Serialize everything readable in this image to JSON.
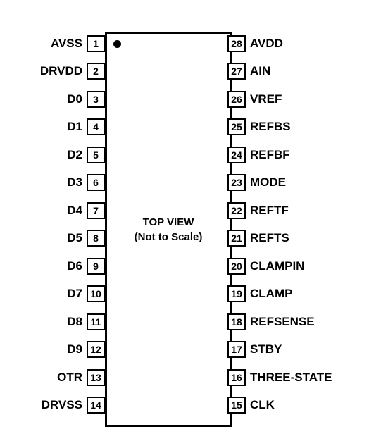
{
  "chip": {
    "top_text": "TOP VIEW",
    "sub_text": "(Not to Scale)"
  },
  "left_pins": [
    {
      "num": "1",
      "label": "AVSS"
    },
    {
      "num": "2",
      "label": "DRVDD"
    },
    {
      "num": "3",
      "label": "D0"
    },
    {
      "num": "4",
      "label": "D1"
    },
    {
      "num": "5",
      "label": "D2"
    },
    {
      "num": "6",
      "label": "D3"
    },
    {
      "num": "7",
      "label": "D4"
    },
    {
      "num": "8",
      "label": "D5"
    },
    {
      "num": "9",
      "label": "D6"
    },
    {
      "num": "10",
      "label": "D7"
    },
    {
      "num": "11",
      "label": "D8"
    },
    {
      "num": "12",
      "label": "D9"
    },
    {
      "num": "13",
      "label": "OTR"
    },
    {
      "num": "14",
      "label": "DRVSS"
    }
  ],
  "right_pins": [
    {
      "num": "28",
      "label": "AVDD"
    },
    {
      "num": "27",
      "label": "AIN"
    },
    {
      "num": "26",
      "label": "VREF"
    },
    {
      "num": "25",
      "label": "REFBS"
    },
    {
      "num": "24",
      "label": "REFBF"
    },
    {
      "num": "23",
      "label": "MODE"
    },
    {
      "num": "22",
      "label": "REFTF"
    },
    {
      "num": "21",
      "label": "REFTS"
    },
    {
      "num": "20",
      "label": "CLAMPIN"
    },
    {
      "num": "19",
      "label": "CLAMP"
    },
    {
      "num": "18",
      "label": "REFSENSE"
    },
    {
      "num": "17",
      "label": "STBY"
    },
    {
      "num": "16",
      "label": "THREE-STATE"
    },
    {
      "num": "15",
      "label": "CLK"
    }
  ]
}
